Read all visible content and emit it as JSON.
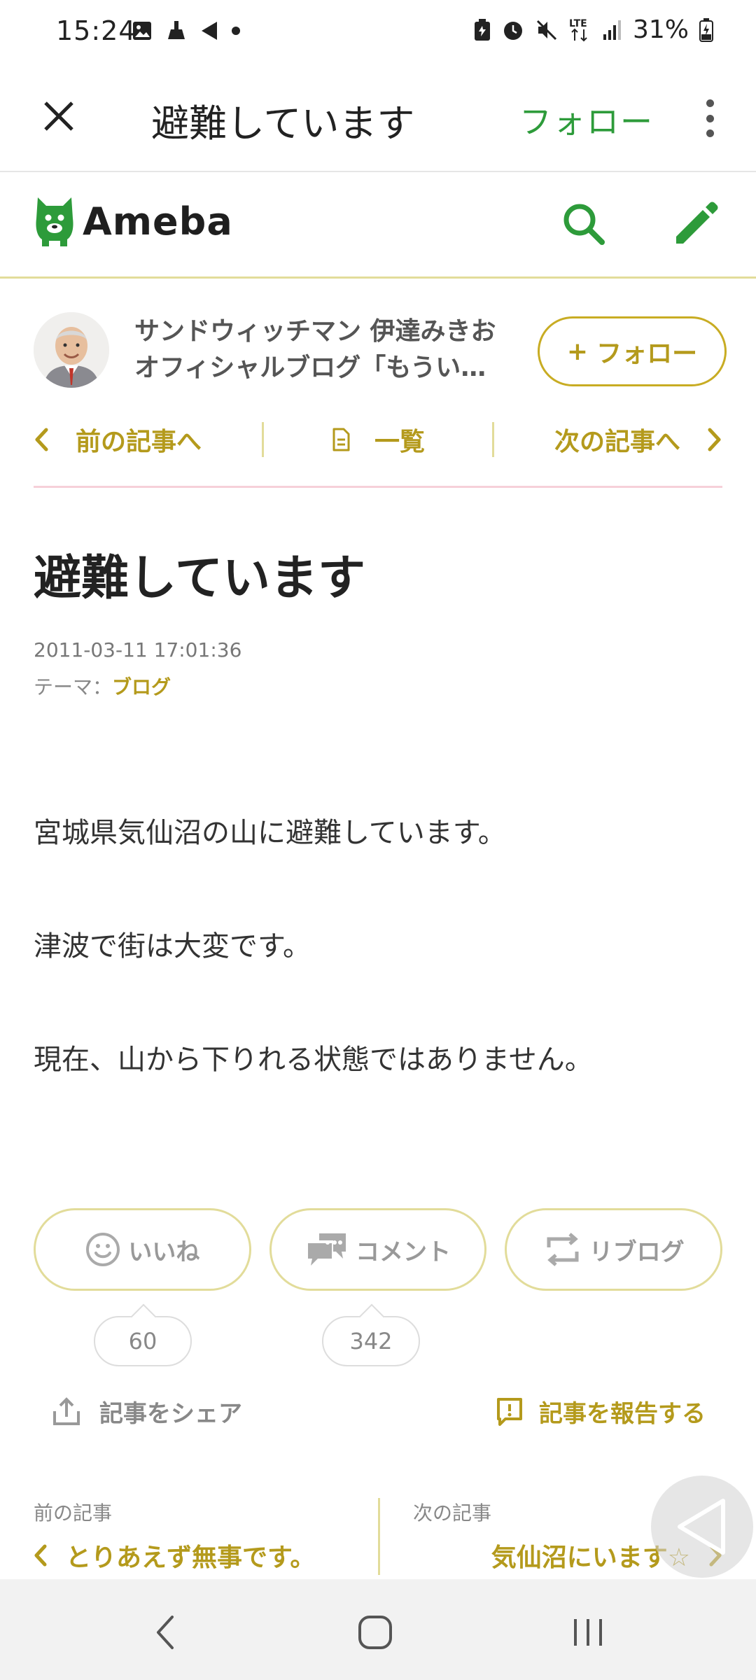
{
  "status_bar": {
    "time": "15:24",
    "network": "LTE",
    "battery_percent": "31%",
    "left_icons": [
      "gallery-icon",
      "broom-icon",
      "navigation-icon",
      "dot-icon"
    ],
    "right_icons": [
      "battery-saver-icon",
      "alarm-icon",
      "mute-icon",
      "lte-icon",
      "signal-icon",
      "battery-icon"
    ]
  },
  "app_bar": {
    "title": "避難しています",
    "follow_label": "フォロー"
  },
  "header": {
    "logo_text": "Ameba"
  },
  "blog": {
    "name_line1": "サンドウィッチマン 伊達みきお",
    "name_line2": "オフィシャルブログ「もうい…",
    "follow_label": "フォロー",
    "follow_plus": "+"
  },
  "nav": {
    "prev_label": "前の記事へ",
    "list_label": "一覧",
    "next_label": "次の記事へ"
  },
  "article": {
    "title": "避難しています",
    "date": "2011-03-11 17:01:36",
    "theme_prefix": "テーマ：",
    "theme_name": "ブログ",
    "paragraphs": [
      "宮城県気仙沼の山に避難しています。",
      "津波で街は大変です。",
      "現在、山から下りれる状態ではありません。"
    ]
  },
  "reactions": {
    "like_label": "いいね",
    "comment_label": "コメント",
    "reblog_label": "リブログ",
    "like_count": "60",
    "comment_count": "342"
  },
  "actions": {
    "share_label": "記事をシェア",
    "report_label": "記事を報告する"
  },
  "footer_nav": {
    "prev_heading": "前の記事",
    "prev_title": "とりあえず無事です。",
    "next_heading": "次の記事",
    "next_title": "気仙沼にいます☆"
  },
  "colors": {
    "accent_green": "#2d9b3a",
    "accent_gold": "#b49a1c",
    "border_gold": "#e2dc9a",
    "divider_pink": "#f6d0d9"
  }
}
